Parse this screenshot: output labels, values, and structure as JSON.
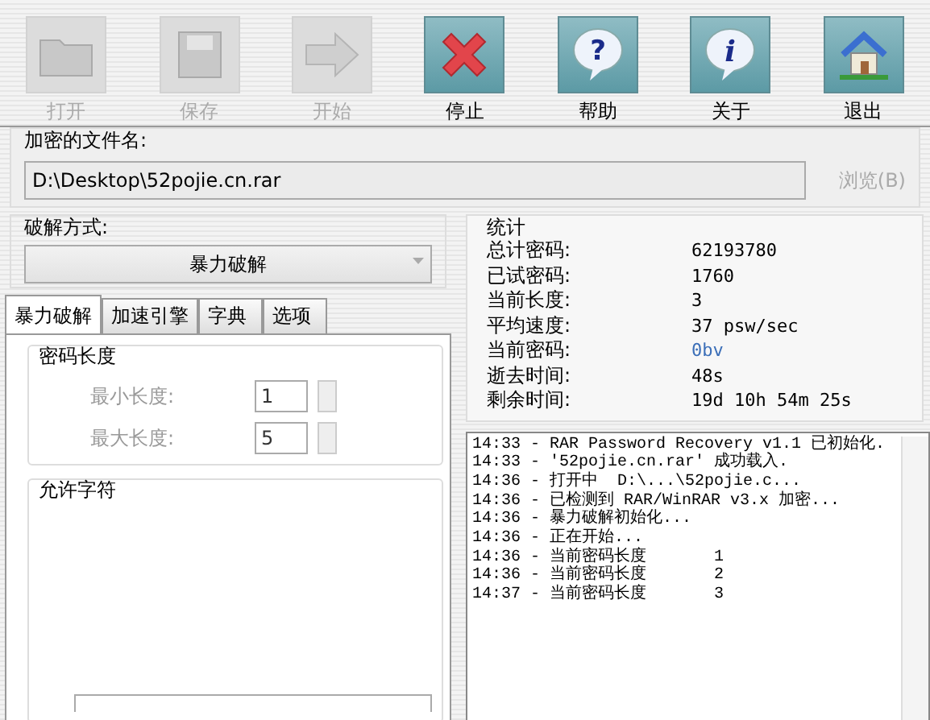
{
  "toolbar": [
    {
      "label": "打开",
      "kind": "open",
      "disabled": true
    },
    {
      "label": "保存",
      "kind": "save",
      "disabled": true
    },
    {
      "label": "开始",
      "kind": "start",
      "disabled": true
    },
    {
      "label": "停止",
      "kind": "stop",
      "disabled": false
    },
    {
      "label": "帮助",
      "kind": "help",
      "disabled": false,
      "glyph": "?"
    },
    {
      "label": "关于",
      "kind": "about",
      "disabled": false,
      "glyph": "i"
    },
    {
      "label": "退出",
      "kind": "exit",
      "disabled": false
    }
  ],
  "file": {
    "label": "加密的文件名:",
    "value": "D:\\Desktop\\52pojie.cn.rar",
    "browse": "浏览(B)",
    "browse_disabled": true
  },
  "method": {
    "label": "破解方式:",
    "value": "暴力破解"
  },
  "tabs": [
    {
      "label": "暴力破解",
      "selected": true
    },
    {
      "label": "加速引擎",
      "selected": false
    },
    {
      "label": "字典",
      "selected": false
    },
    {
      "label": "选项",
      "selected": false
    }
  ],
  "length": {
    "title": "密码长度",
    "fields": [
      {
        "label": "最小长度:",
        "value": "1"
      },
      {
        "label": "最大长度:",
        "value": "5"
      }
    ]
  },
  "charset": {
    "title": "允许字符"
  },
  "stats": {
    "title": "统计",
    "rows": [
      {
        "label": "总计密码:",
        "value": "62193780",
        "highlight": false
      },
      {
        "label": "已试密码:",
        "value": "1760",
        "highlight": false
      },
      {
        "label": "当前长度:",
        "value": "3",
        "highlight": false
      },
      {
        "label": "平均速度:",
        "value": "37 psw/sec",
        "highlight": false
      },
      {
        "label": "当前密码:",
        "value": "0bv",
        "highlight": true
      },
      {
        "label": "逝去时间:",
        "value": "48s",
        "highlight": false
      },
      {
        "label": "剩余时间:",
        "value": "19d 10h 54m 25s",
        "highlight": false
      }
    ]
  },
  "log": [
    {
      "text": "14:33 - RAR Password Recovery v1.1 已初始化."
    },
    {
      "text": "14:33 - '52pojie.cn.rar' 成功载入."
    },
    {
      "text": "14:36 - 打开中  D:\\...\\52pojie.c..."
    },
    {
      "text": "14:36 - 已检测到 RAR/WinRAR v3.x 加密..."
    },
    {
      "text": "14:36 - 暴力破解初始化..."
    },
    {
      "text": "14:36 - 正在开始..."
    },
    {
      "text": "14:36 - 当前密码长度",
      "value": "1"
    },
    {
      "text": "14:36 - 当前密码长度",
      "value": "2"
    },
    {
      "text": "14:37 - 当前密码长度",
      "value": "3"
    }
  ]
}
